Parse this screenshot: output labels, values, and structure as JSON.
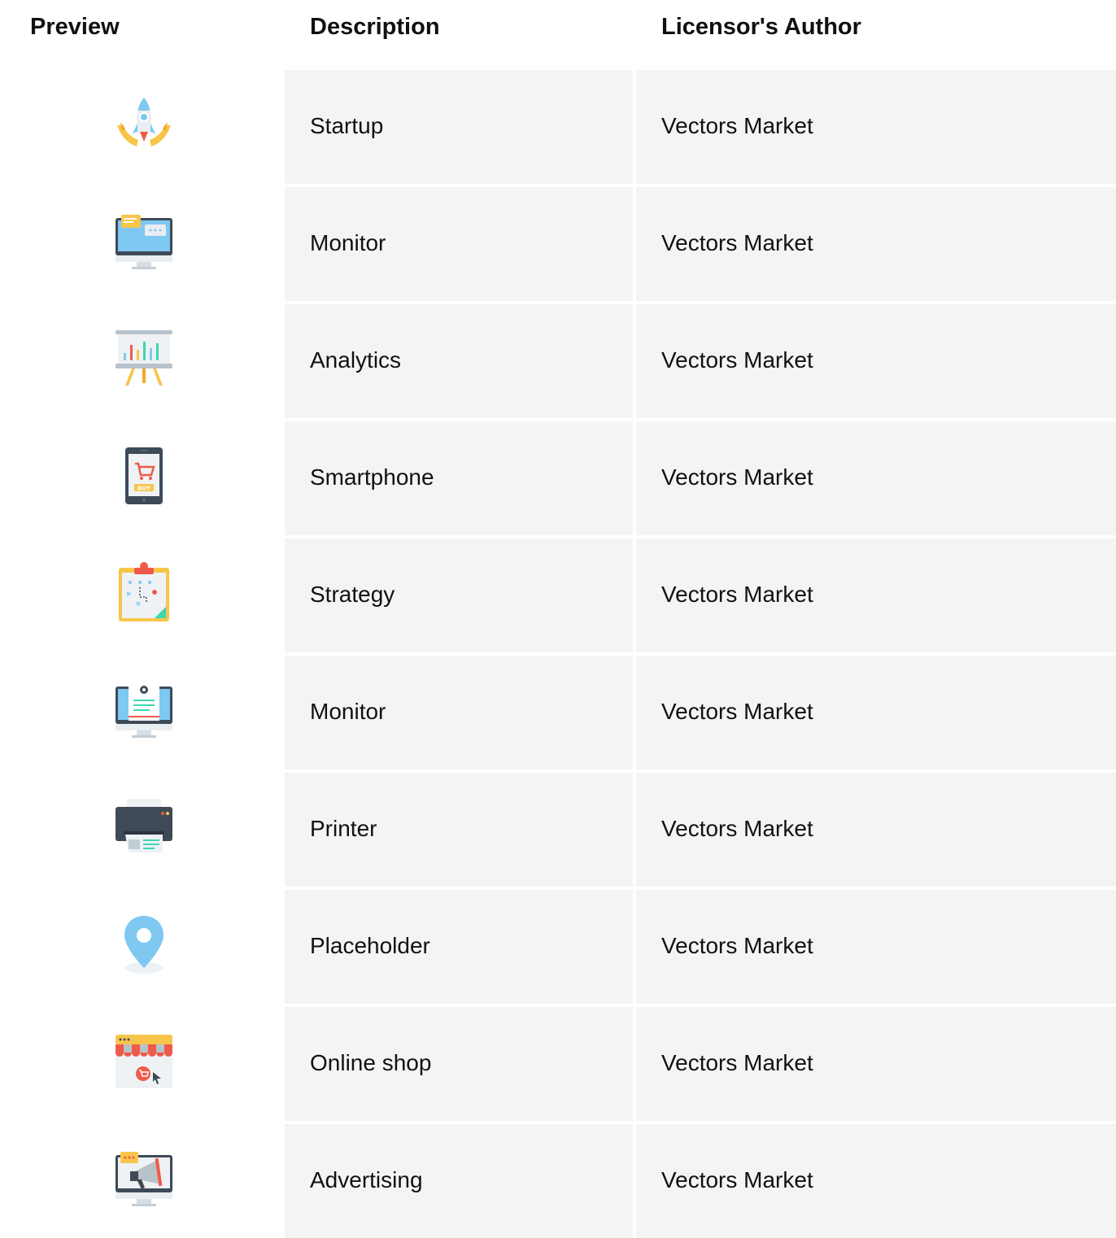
{
  "headers": {
    "preview": "Preview",
    "description": "Description",
    "author": "Licensor's Author"
  },
  "rows": [
    {
      "icon": "rocket-hands-icon",
      "description": "Startup",
      "author": "Vectors Market"
    },
    {
      "icon": "monitor-chat-icon",
      "description": "Monitor",
      "author": "Vectors Market"
    },
    {
      "icon": "analytics-board-icon",
      "description": "Analytics",
      "author": "Vectors Market"
    },
    {
      "icon": "smartphone-buy-icon",
      "description": "Smartphone",
      "author": "Vectors Market"
    },
    {
      "icon": "strategy-clipboard-icon",
      "description": "Strategy",
      "author": "Vectors Market"
    },
    {
      "icon": "monitor-document-icon",
      "description": "Monitor",
      "author": "Vectors Market"
    },
    {
      "icon": "printer-icon",
      "description": "Printer",
      "author": "Vectors Market"
    },
    {
      "icon": "map-pin-icon",
      "description": "Placeholder",
      "author": "Vectors Market"
    },
    {
      "icon": "online-shop-icon",
      "description": "Online shop",
      "author": "Vectors Market"
    },
    {
      "icon": "advertising-monitor-icon",
      "description": "Advertising",
      "author": "Vectors Market"
    }
  ],
  "colors": {
    "row_bg": "#f4f4f4",
    "monitor_frame": "#3f4a57",
    "screen_blue": "#7fc8f2",
    "accent_yellow": "#f7c54a",
    "accent_red": "#ef5a4a",
    "accent_green": "#3dd6b0"
  }
}
